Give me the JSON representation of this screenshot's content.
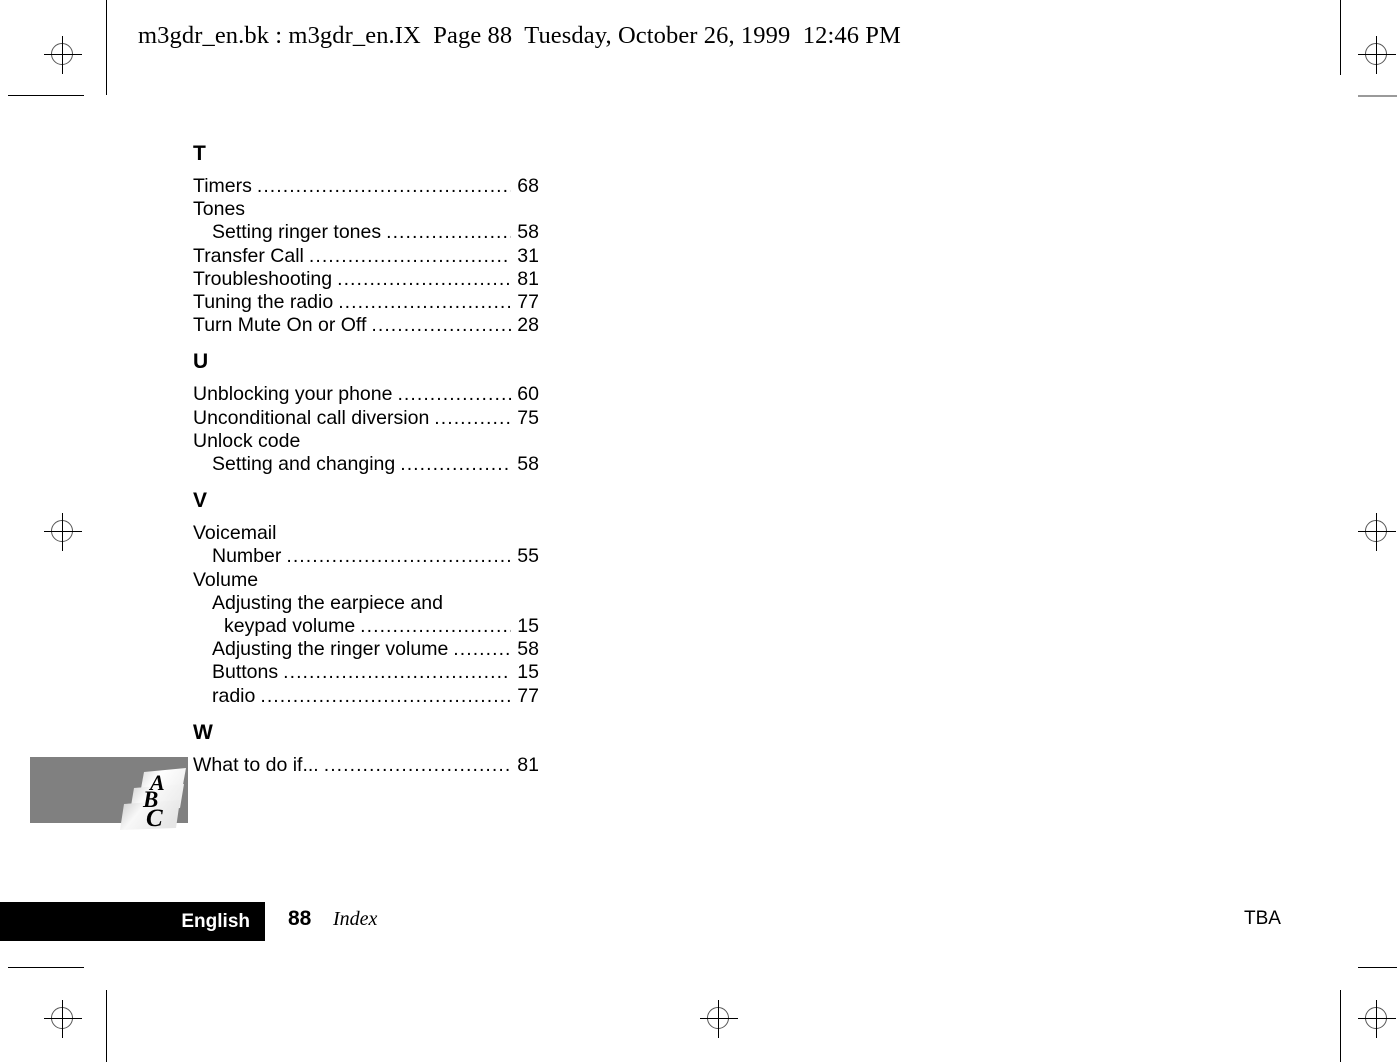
{
  "header": {
    "text": "m3gdr_en.bk : m3gdr_en.IX  Page 88  Tuesday, October 26, 1999  12:46 PM"
  },
  "index": {
    "sections": [
      {
        "letter": "T",
        "entries": [
          {
            "label": "Timers",
            "page": "68",
            "level": 0,
            "leader": true
          },
          {
            "label": "Tones",
            "page": "",
            "level": 0,
            "leader": false
          },
          {
            "label": "Setting ringer tones",
            "page": "58",
            "level": 1,
            "leader": true
          },
          {
            "label": "Transfer Call",
            "page": "31",
            "level": 0,
            "leader": true
          },
          {
            "label": "Troubleshooting",
            "page": "81",
            "level": 0,
            "leader": true
          },
          {
            "label": "Tuning the radio",
            "page": "77",
            "level": 0,
            "leader": true
          },
          {
            "label": "Turn Mute On or Off",
            "page": "28",
            "level": 0,
            "leader": true
          }
        ]
      },
      {
        "letter": "U",
        "entries": [
          {
            "label": "Unblocking your phone",
            "page": "60",
            "level": 0,
            "leader": true
          },
          {
            "label": "Unconditional call diversion",
            "page": "75",
            "level": 0,
            "leader": true
          },
          {
            "label": "Unlock code",
            "page": "",
            "level": 0,
            "leader": false
          },
          {
            "label": "Setting and changing",
            "page": "58",
            "level": 1,
            "leader": true
          }
        ]
      },
      {
        "letter": "V",
        "entries": [
          {
            "label": "Voicemail",
            "page": "",
            "level": 0,
            "leader": false
          },
          {
            "label": "Number",
            "page": "55",
            "level": 1,
            "leader": true
          },
          {
            "label": "Volume",
            "page": "",
            "level": 0,
            "leader": false
          },
          {
            "label": "Adjusting the earpiece and",
            "page": "",
            "level": 1,
            "leader": false
          },
          {
            "label": "keypad volume",
            "page": "15",
            "level": 2,
            "leader": true
          },
          {
            "label": "Adjusting the ringer volume",
            "page": "58",
            "level": 1,
            "leader": true
          },
          {
            "label": "Buttons",
            "page": "15",
            "level": 1,
            "leader": true
          },
          {
            "label": "radio",
            "page": "77",
            "level": 1,
            "leader": true
          }
        ]
      },
      {
        "letter": "W",
        "entries": [
          {
            "label": "What to do if...",
            "page": "81",
            "level": 0,
            "leader": true
          }
        ]
      }
    ]
  },
  "logo": {
    "name": "abc-logo",
    "letters": [
      "A",
      "B",
      "C"
    ],
    "band_color": "#808080"
  },
  "footer": {
    "language": "English",
    "page_number": "88",
    "section_name": "Index",
    "right_label": "TBA"
  },
  "print_marks": {
    "registration_icon": "registration-crosshair-icon",
    "trim_line_icon": "trim-line-icon"
  }
}
